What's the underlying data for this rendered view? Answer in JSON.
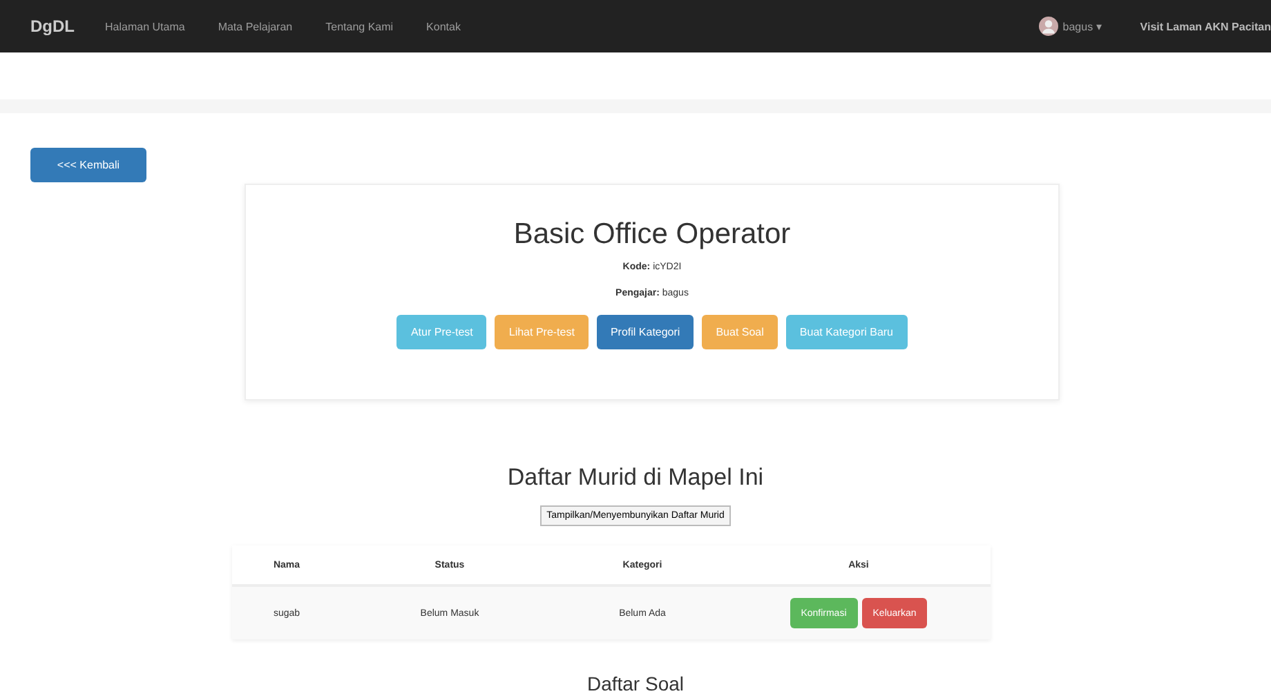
{
  "navbar": {
    "brand": "DgDL",
    "links": [
      "Halaman Utama",
      "Mata Pelajaran",
      "Tentang Kami",
      "Kontak"
    ],
    "user": "bagus",
    "caret": "▾",
    "site_link": "Visit Laman AKN Pacitan"
  },
  "back_button": "<<< Kembali",
  "course": {
    "title": "Basic Office Operator",
    "code_label": "Kode:",
    "code": "icYD2I",
    "teacher_label": "Pengajar:",
    "teacher": "bagus",
    "buttons": [
      {
        "label": "Atur Pre-test",
        "kind": "info"
      },
      {
        "label": "Lihat Pre-test",
        "kind": "warning"
      },
      {
        "label": "Profil Kategori",
        "kind": "primary"
      },
      {
        "label": "Buat Soal",
        "kind": "warning"
      },
      {
        "label": "Buat Kategori Baru",
        "kind": "info"
      }
    ]
  },
  "students": {
    "heading": "Daftar Murid di Mapel Ini",
    "toggle": "Tampilkan/Menyembunyikan Daftar Murid",
    "columns": [
      "Nama",
      "Status",
      "Kategori",
      "Aksi"
    ],
    "rows": [
      {
        "name": "sugab",
        "status": "Belum Masuk",
        "category": "Belum Ada",
        "actions": [
          {
            "label": "Konfirmasi",
            "kind": "success"
          },
          {
            "label": "Keluarkan",
            "kind": "danger"
          }
        ]
      }
    ]
  },
  "questions": {
    "heading": "Daftar Soal"
  }
}
